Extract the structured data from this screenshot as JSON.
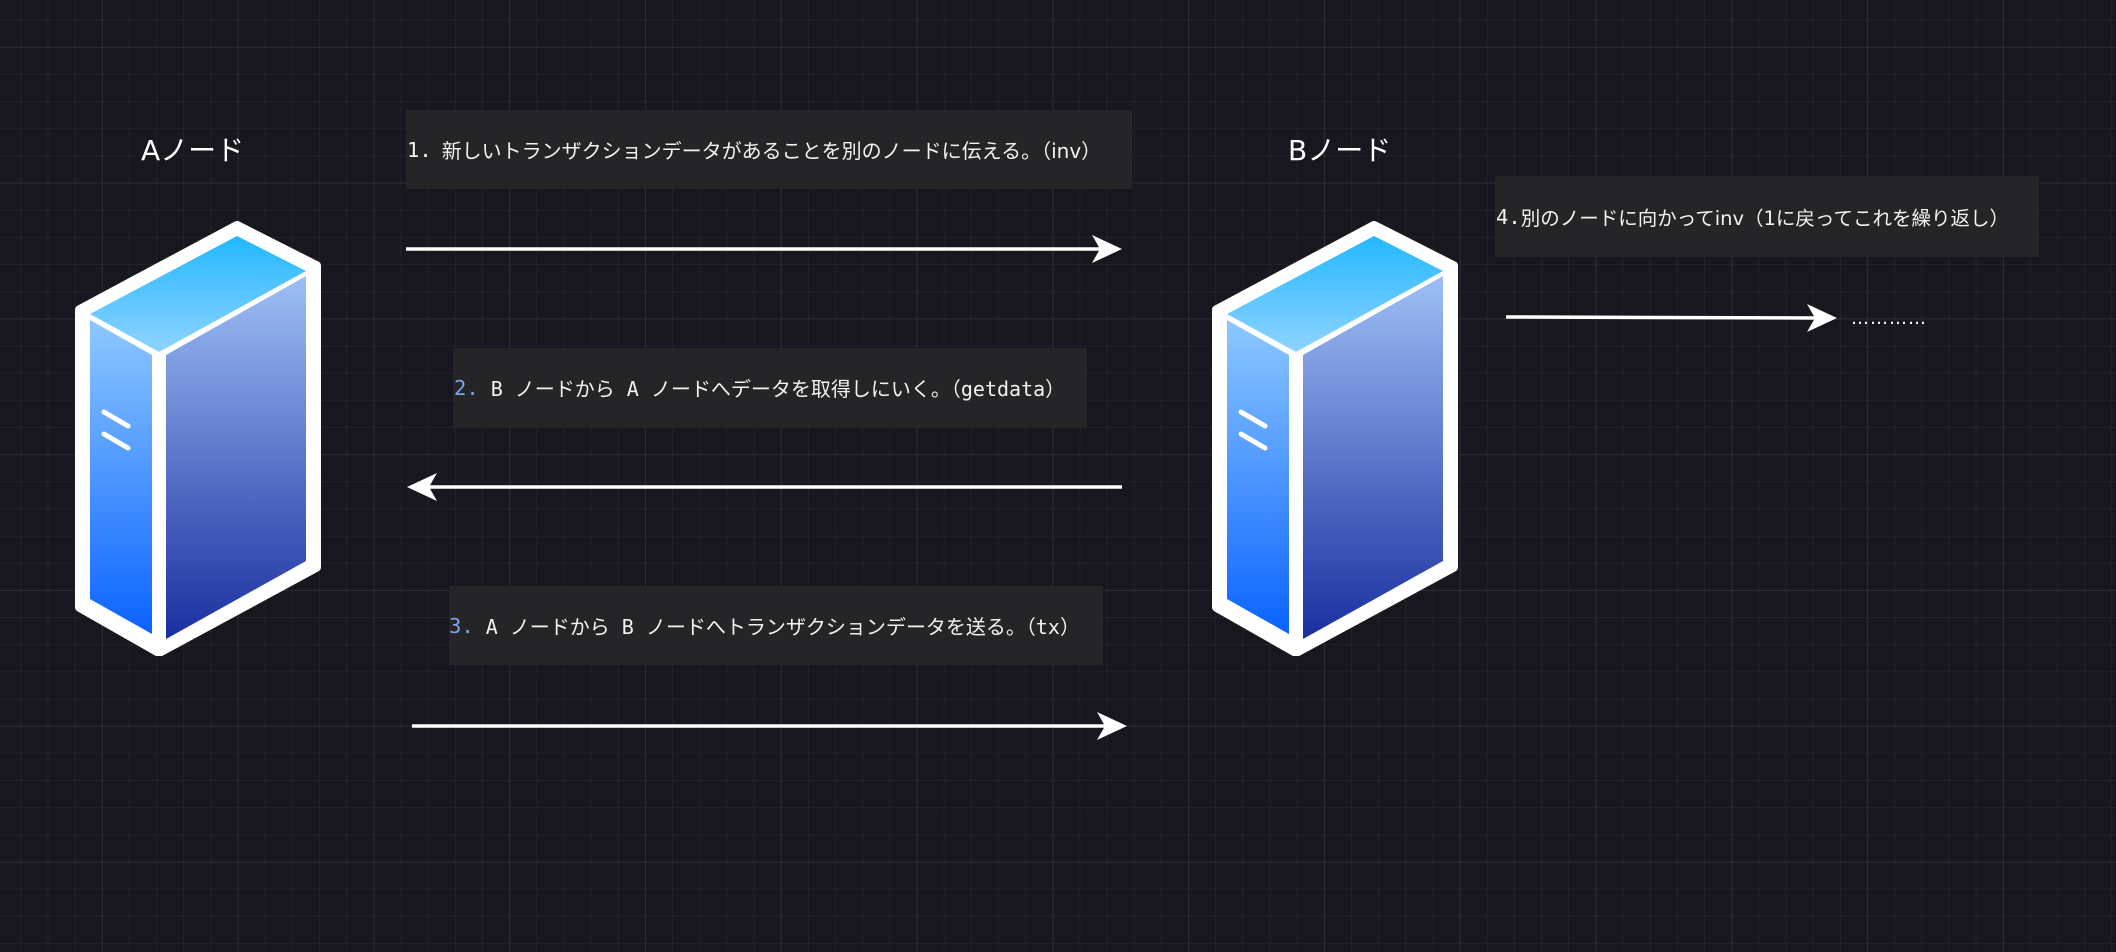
{
  "nodes": {
    "a": {
      "label": "Aノード"
    },
    "b": {
      "label": "Bノード"
    }
  },
  "messages": [
    {
      "number": "1.",
      "text": "新しいトランザクションデータがあることを別のノードに伝える。（inv）"
    },
    {
      "number": "2.",
      "text": "B ノードから A ノードへデータを取得しにいく。（getdata）"
    },
    {
      "number": "3.",
      "text": "A ノードから B ノードへトランザクションデータを送る。（tx）"
    },
    {
      "number": "4.",
      "text": "別のノードに向かってinv（1に戻ってこれを繰り返し）"
    }
  ],
  "continuation": "…………",
  "colors": {
    "background": "#18171f",
    "grid_major": "#2c2b33",
    "grid_minor": "#222129",
    "label_box": "#252528",
    "arrow": "#ffffff",
    "number_accent": "#7fa3e8",
    "server_top_from": "#22b8ff",
    "server_front_bottom": "#1a2fa0",
    "server_side_bottom": "#0a63ff"
  },
  "icons": {
    "server": "server-icon",
    "arrow": "arrow-icon"
  }
}
